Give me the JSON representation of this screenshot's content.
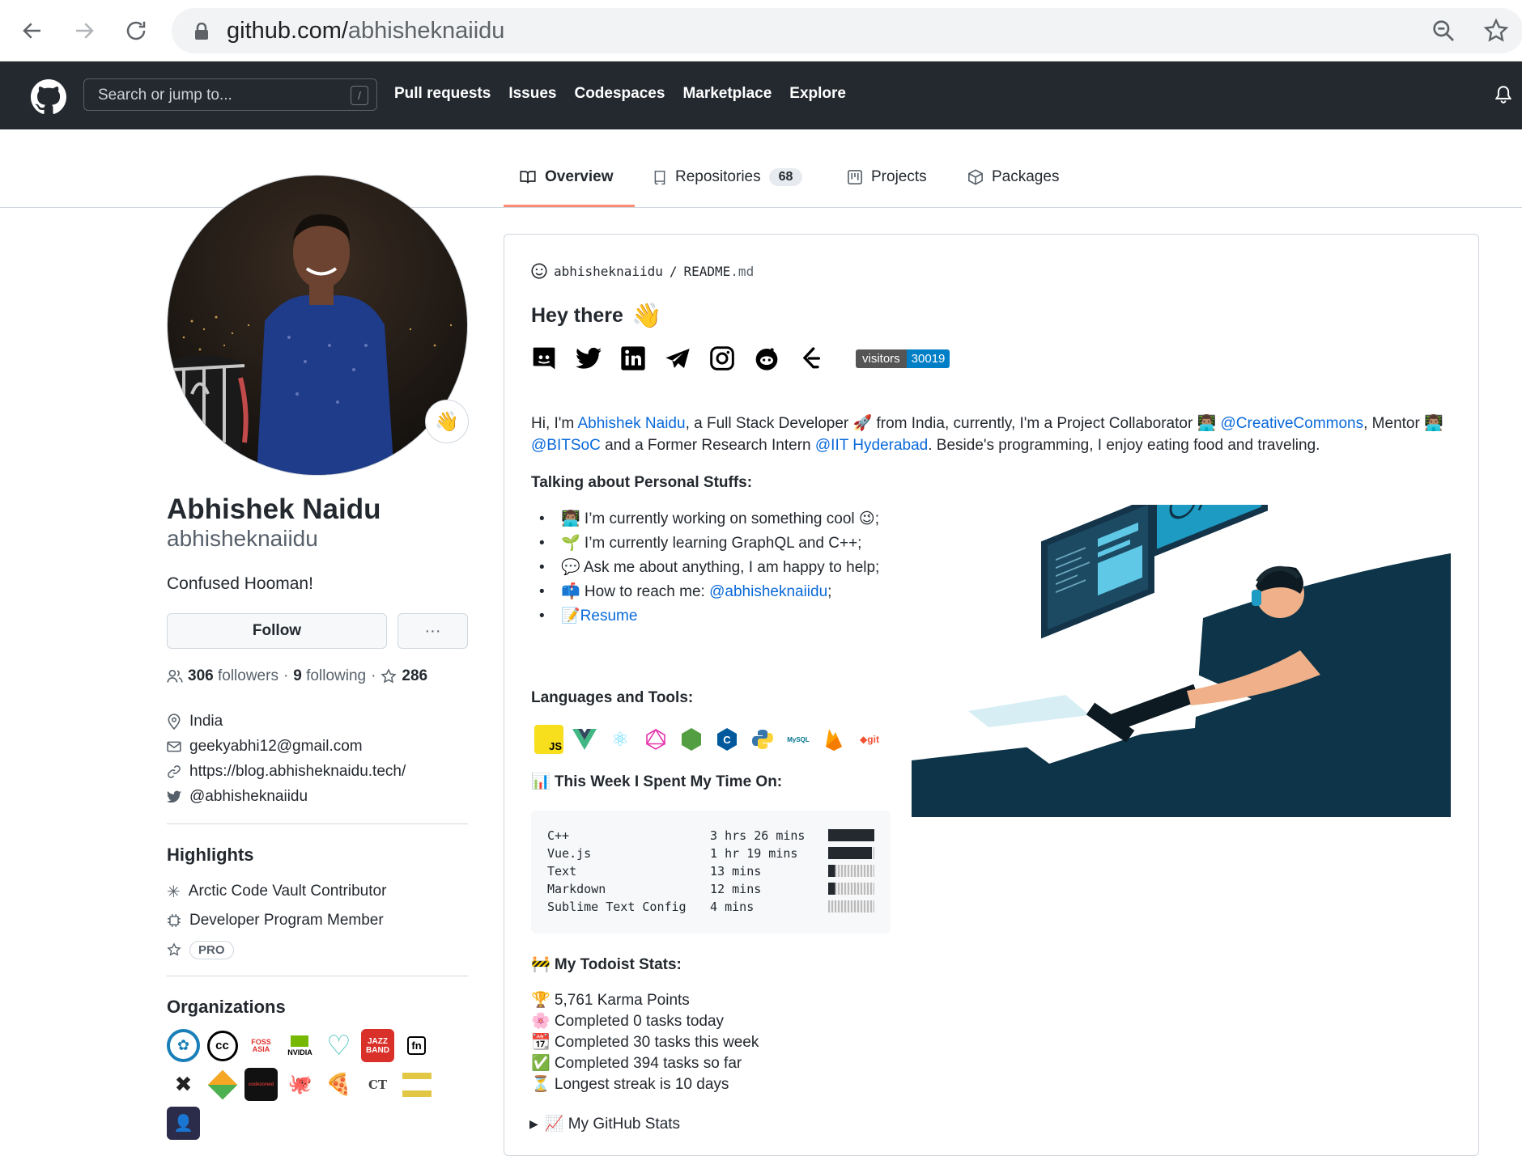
{
  "browser": {
    "url_host": "github.com/",
    "url_path": "abhisheknaiidu"
  },
  "header": {
    "search_placeholder": "Search or jump to...",
    "search_shortcut": "/",
    "nav": [
      "Pull requests",
      "Issues",
      "Codespaces",
      "Marketplace",
      "Explore"
    ]
  },
  "tabs": {
    "overview": "Overview",
    "repositories": "Repositories",
    "repositories_count": "68",
    "projects": "Projects",
    "packages": "Packages"
  },
  "profile": {
    "name": "Abhishek Naidu",
    "login": "abhisheknaiidu",
    "bio": "Confused Hooman!",
    "follow_label": "Follow",
    "more_label": "···",
    "followers_count": "306",
    "followers_label": "followers",
    "following_count": "9",
    "following_label": "following",
    "stars_count": "286",
    "location": "India",
    "email": "geekyabhi12@gmail.com",
    "website": "https://blog.abhisheknaidu.tech/",
    "twitter": "@abhisheknaiidu"
  },
  "highlights": {
    "title": "Highlights",
    "items": [
      "Arctic Code Vault Contributor",
      "Developer Program Member"
    ],
    "pro": "PRO"
  },
  "organizations": {
    "title": "Organizations"
  },
  "readme": {
    "path_user": "abhisheknaiidu",
    "path_sep": "/",
    "path_file": "README",
    "path_ext": ".md",
    "greeting": "Hey there",
    "visitors_label": "visitors",
    "visitors_count": "30019",
    "intro": {
      "p1": "Hi, I'm ",
      "name_link": "Abhishek Naidu",
      "p2": ", a Full Stack Developer 🚀 from India, currently, I'm a Project Collaborator 👨🏽‍💻 ",
      "cc_link": "@CreativeCommons",
      "p3": ", Mentor 👨🏽‍💻",
      "bitsoc_link": "@BITSoC",
      "p4": " and a Former Research Intern ",
      "iit_link": "@IIT Hyderabad",
      "p5": ". Beside's programming, I enjoy eating food and traveling."
    },
    "personal_title": "Talking about Personal Stuffs:",
    "bullets": {
      "b1": "👨🏽‍💻 I’m currently working on something cool 😉;",
      "b2": "🌱 I’m currently learning GraphQL and C++;",
      "b3": "💬 Ask me about anything, I am happy to help;",
      "b4_text": "📫 How to reach me: ",
      "b4_link": "@abhisheknaiidu",
      "b4_end": ";",
      "b5_icon": "📝",
      "b5_link": "Resume"
    },
    "langs_title": "Languages and Tools:",
    "week_title": "📊 This Week I Spent My Time On:",
    "wakatime": [
      {
        "lang": "C++",
        "time": "3 hrs 26 mins",
        "fill": 1.0
      },
      {
        "lang": "Vue.js",
        "time": "1 hr 19 mins",
        "fill": 0.95
      },
      {
        "lang": "Text",
        "time": "13 mins",
        "fill": 0.15
      },
      {
        "lang": "Markdown",
        "time": "12 mins",
        "fill": 0.15
      },
      {
        "lang": "Sublime Text Config",
        "time": "4 mins",
        "fill": 0.0
      }
    ],
    "todoist_title": "🚧 My Todoist Stats:",
    "todoist": {
      "t1": "🏆 5,761 Karma Points",
      "t2": "🌸 Completed 0 tasks today",
      "t3": "📆 Completed 30 tasks this week",
      "t4": "✅ Completed 394 tasks so far",
      "t5": "⏳ Longest streak is 10 days"
    },
    "github_stats": "📈 My GitHub Stats"
  }
}
